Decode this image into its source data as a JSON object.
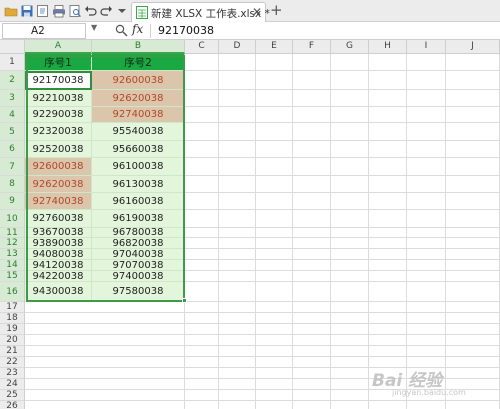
{
  "toolbar": {
    "tab_title": "新建 XLSX 工作表.xlsx *",
    "tab_close": "✕",
    "tab_add": "+"
  },
  "formula_bar": {
    "cell_ref": "A2",
    "fx_label": "fx",
    "formula": "92170038"
  },
  "columns": [
    "A",
    "B",
    "C",
    "D",
    "E",
    "F",
    "G",
    "H",
    "I",
    "J"
  ],
  "rows": [
    "1",
    "2",
    "3",
    "4",
    "5",
    "6",
    "7",
    "8",
    "9",
    "10",
    "11",
    "12",
    "13",
    "14",
    "15",
    "16",
    "17",
    "18",
    "19",
    "20",
    "21",
    "22",
    "23",
    "24",
    "25",
    "26"
  ],
  "table": {
    "headers": [
      "序号1",
      "序号2"
    ],
    "col_a": [
      "92170038",
      "92210038",
      "92290038",
      "92320038",
      "92520038",
      "92600038",
      "92620038",
      "92740038",
      "92760038",
      "93670038",
      "93890038",
      "94080038",
      "94120038",
      "94220038",
      "94300038"
    ],
    "col_b": [
      "92600038",
      "92620038",
      "92740038",
      "95540038",
      "95660038",
      "96100038",
      "96130038",
      "96160038",
      "96190038",
      "96780038",
      "96820038",
      "97040038",
      "97070038",
      "97400038",
      "97580038"
    ]
  },
  "watermark": {
    "text": "Bai 经验",
    "sub": "jingyan.baidu.com"
  },
  "colors": {
    "header_green": "#1aa843",
    "light_green": "#e3f6dc",
    "duplicate_fill": "#dcc6ab",
    "duplicate_text": "#b1472a"
  }
}
